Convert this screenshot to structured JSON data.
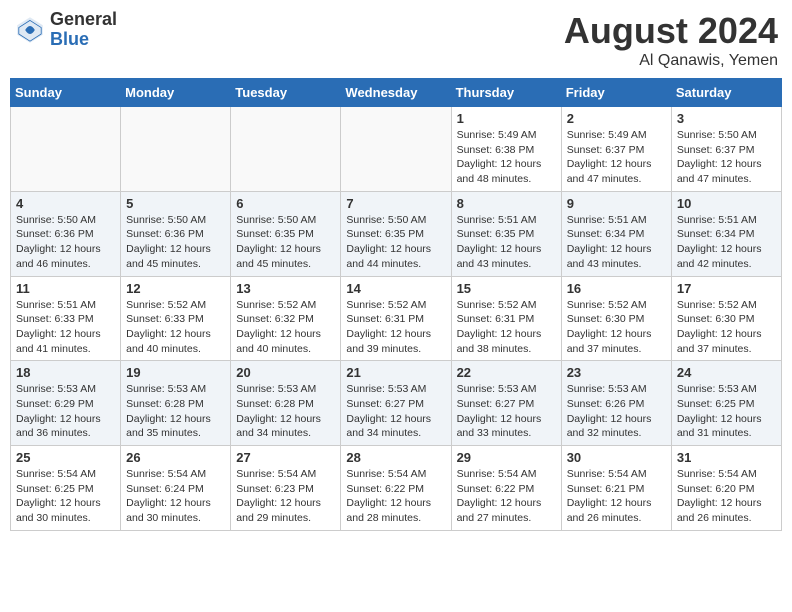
{
  "logo": {
    "general": "General",
    "blue": "Blue"
  },
  "title": {
    "month_year": "August 2024",
    "location": "Al Qanawis, Yemen"
  },
  "weekdays": [
    "Sunday",
    "Monday",
    "Tuesday",
    "Wednesday",
    "Thursday",
    "Friday",
    "Saturday"
  ],
  "weeks": [
    [
      {
        "day": "",
        "info": ""
      },
      {
        "day": "",
        "info": ""
      },
      {
        "day": "",
        "info": ""
      },
      {
        "day": "",
        "info": ""
      },
      {
        "day": "1",
        "info": "Sunrise: 5:49 AM\nSunset: 6:38 PM\nDaylight: 12 hours\nand 48 minutes."
      },
      {
        "day": "2",
        "info": "Sunrise: 5:49 AM\nSunset: 6:37 PM\nDaylight: 12 hours\nand 47 minutes."
      },
      {
        "day": "3",
        "info": "Sunrise: 5:50 AM\nSunset: 6:37 PM\nDaylight: 12 hours\nand 47 minutes."
      }
    ],
    [
      {
        "day": "4",
        "info": "Sunrise: 5:50 AM\nSunset: 6:36 PM\nDaylight: 12 hours\nand 46 minutes."
      },
      {
        "day": "5",
        "info": "Sunrise: 5:50 AM\nSunset: 6:36 PM\nDaylight: 12 hours\nand 45 minutes."
      },
      {
        "day": "6",
        "info": "Sunrise: 5:50 AM\nSunset: 6:35 PM\nDaylight: 12 hours\nand 45 minutes."
      },
      {
        "day": "7",
        "info": "Sunrise: 5:50 AM\nSunset: 6:35 PM\nDaylight: 12 hours\nand 44 minutes."
      },
      {
        "day": "8",
        "info": "Sunrise: 5:51 AM\nSunset: 6:35 PM\nDaylight: 12 hours\nand 43 minutes."
      },
      {
        "day": "9",
        "info": "Sunrise: 5:51 AM\nSunset: 6:34 PM\nDaylight: 12 hours\nand 43 minutes."
      },
      {
        "day": "10",
        "info": "Sunrise: 5:51 AM\nSunset: 6:34 PM\nDaylight: 12 hours\nand 42 minutes."
      }
    ],
    [
      {
        "day": "11",
        "info": "Sunrise: 5:51 AM\nSunset: 6:33 PM\nDaylight: 12 hours\nand 41 minutes."
      },
      {
        "day": "12",
        "info": "Sunrise: 5:52 AM\nSunset: 6:33 PM\nDaylight: 12 hours\nand 40 minutes."
      },
      {
        "day": "13",
        "info": "Sunrise: 5:52 AM\nSunset: 6:32 PM\nDaylight: 12 hours\nand 40 minutes."
      },
      {
        "day": "14",
        "info": "Sunrise: 5:52 AM\nSunset: 6:31 PM\nDaylight: 12 hours\nand 39 minutes."
      },
      {
        "day": "15",
        "info": "Sunrise: 5:52 AM\nSunset: 6:31 PM\nDaylight: 12 hours\nand 38 minutes."
      },
      {
        "day": "16",
        "info": "Sunrise: 5:52 AM\nSunset: 6:30 PM\nDaylight: 12 hours\nand 37 minutes."
      },
      {
        "day": "17",
        "info": "Sunrise: 5:52 AM\nSunset: 6:30 PM\nDaylight: 12 hours\nand 37 minutes."
      }
    ],
    [
      {
        "day": "18",
        "info": "Sunrise: 5:53 AM\nSunset: 6:29 PM\nDaylight: 12 hours\nand 36 minutes."
      },
      {
        "day": "19",
        "info": "Sunrise: 5:53 AM\nSunset: 6:28 PM\nDaylight: 12 hours\nand 35 minutes."
      },
      {
        "day": "20",
        "info": "Sunrise: 5:53 AM\nSunset: 6:28 PM\nDaylight: 12 hours\nand 34 minutes."
      },
      {
        "day": "21",
        "info": "Sunrise: 5:53 AM\nSunset: 6:27 PM\nDaylight: 12 hours\nand 34 minutes."
      },
      {
        "day": "22",
        "info": "Sunrise: 5:53 AM\nSunset: 6:27 PM\nDaylight: 12 hours\nand 33 minutes."
      },
      {
        "day": "23",
        "info": "Sunrise: 5:53 AM\nSunset: 6:26 PM\nDaylight: 12 hours\nand 32 minutes."
      },
      {
        "day": "24",
        "info": "Sunrise: 5:53 AM\nSunset: 6:25 PM\nDaylight: 12 hours\nand 31 minutes."
      }
    ],
    [
      {
        "day": "25",
        "info": "Sunrise: 5:54 AM\nSunset: 6:25 PM\nDaylight: 12 hours\nand 30 minutes."
      },
      {
        "day": "26",
        "info": "Sunrise: 5:54 AM\nSunset: 6:24 PM\nDaylight: 12 hours\nand 30 minutes."
      },
      {
        "day": "27",
        "info": "Sunrise: 5:54 AM\nSunset: 6:23 PM\nDaylight: 12 hours\nand 29 minutes."
      },
      {
        "day": "28",
        "info": "Sunrise: 5:54 AM\nSunset: 6:22 PM\nDaylight: 12 hours\nand 28 minutes."
      },
      {
        "day": "29",
        "info": "Sunrise: 5:54 AM\nSunset: 6:22 PM\nDaylight: 12 hours\nand 27 minutes."
      },
      {
        "day": "30",
        "info": "Sunrise: 5:54 AM\nSunset: 6:21 PM\nDaylight: 12 hours\nand 26 minutes."
      },
      {
        "day": "31",
        "info": "Sunrise: 5:54 AM\nSunset: 6:20 PM\nDaylight: 12 hours\nand 26 minutes."
      }
    ]
  ]
}
